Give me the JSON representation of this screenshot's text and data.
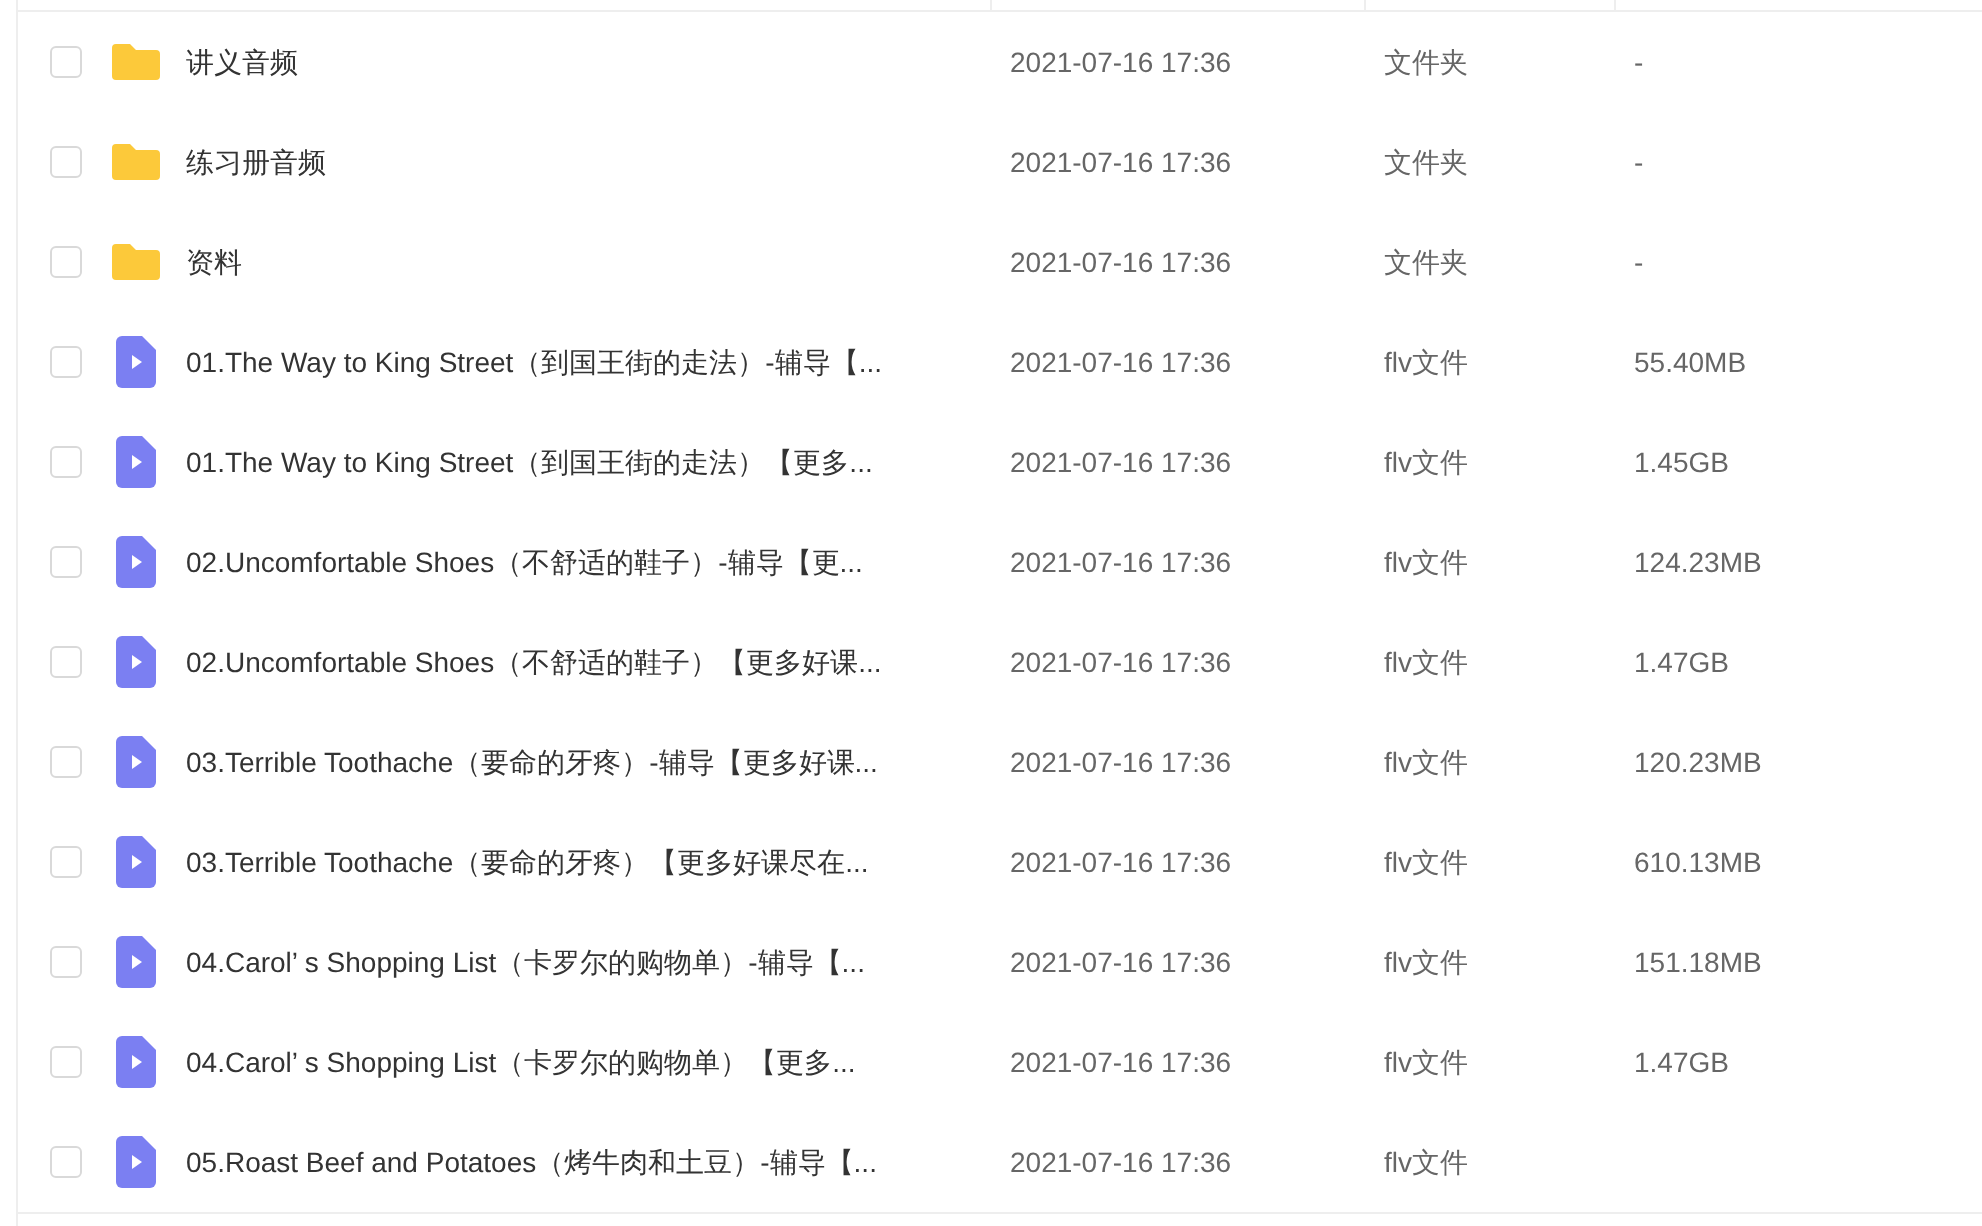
{
  "files": [
    {
      "kind": "folder",
      "checked": false,
      "name": "讲义音频",
      "modified": "2021-07-16 17:36",
      "type": "文件夹",
      "size": "-"
    },
    {
      "kind": "folder",
      "checked": false,
      "name": "练习册音频",
      "modified": "2021-07-16 17:36",
      "type": "文件夹",
      "size": "-"
    },
    {
      "kind": "folder",
      "checked": false,
      "name": "资料",
      "modified": "2021-07-16 17:36",
      "type": "文件夹",
      "size": "-"
    },
    {
      "kind": "video",
      "checked": false,
      "name": "01.The Way to King Street（到国王街的走法）-辅导【...",
      "modified": "2021-07-16 17:36",
      "type": "flv文件",
      "size": "55.40MB"
    },
    {
      "kind": "video",
      "checked": false,
      "name": "01.The Way to King Street（到国王街的走法）【更多...",
      "modified": "2021-07-16 17:36",
      "type": "flv文件",
      "size": "1.45GB"
    },
    {
      "kind": "video",
      "checked": false,
      "name": "02.Uncomfortable Shoes（不舒适的鞋子）-辅导【更...",
      "modified": "2021-07-16 17:36",
      "type": "flv文件",
      "size": "124.23MB"
    },
    {
      "kind": "video",
      "checked": false,
      "name": "02.Uncomfortable Shoes（不舒适的鞋子）【更多好课...",
      "modified": "2021-07-16 17:36",
      "type": "flv文件",
      "size": "1.47GB"
    },
    {
      "kind": "video",
      "checked": false,
      "name": "03.Terrible Toothache（要命的牙疼）-辅导【更多好课...",
      "modified": "2021-07-16 17:36",
      "type": "flv文件",
      "size": "120.23MB"
    },
    {
      "kind": "video",
      "checked": false,
      "name": "03.Terrible Toothache（要命的牙疼）【更多好课尽在...",
      "modified": "2021-07-16 17:36",
      "type": "flv文件",
      "size": "610.13MB"
    },
    {
      "kind": "video",
      "checked": false,
      "name": "04.Carol’ s Shopping List（卡罗尔的购物单）-辅导【...",
      "modified": "2021-07-16 17:36",
      "type": "flv文件",
      "size": "151.18MB"
    },
    {
      "kind": "video",
      "checked": false,
      "name": "04.Carol’ s Shopping List（卡罗尔的购物单）【更多...",
      "modified": "2021-07-16 17:36",
      "type": "flv文件",
      "size": "1.47GB"
    },
    {
      "kind": "video",
      "checked": false,
      "name": "05.Roast Beef and Potatoes（烤牛肉和土豆）-辅导【...",
      "modified": "2021-07-16 17:36",
      "type": "flv文件"
    }
  ]
}
